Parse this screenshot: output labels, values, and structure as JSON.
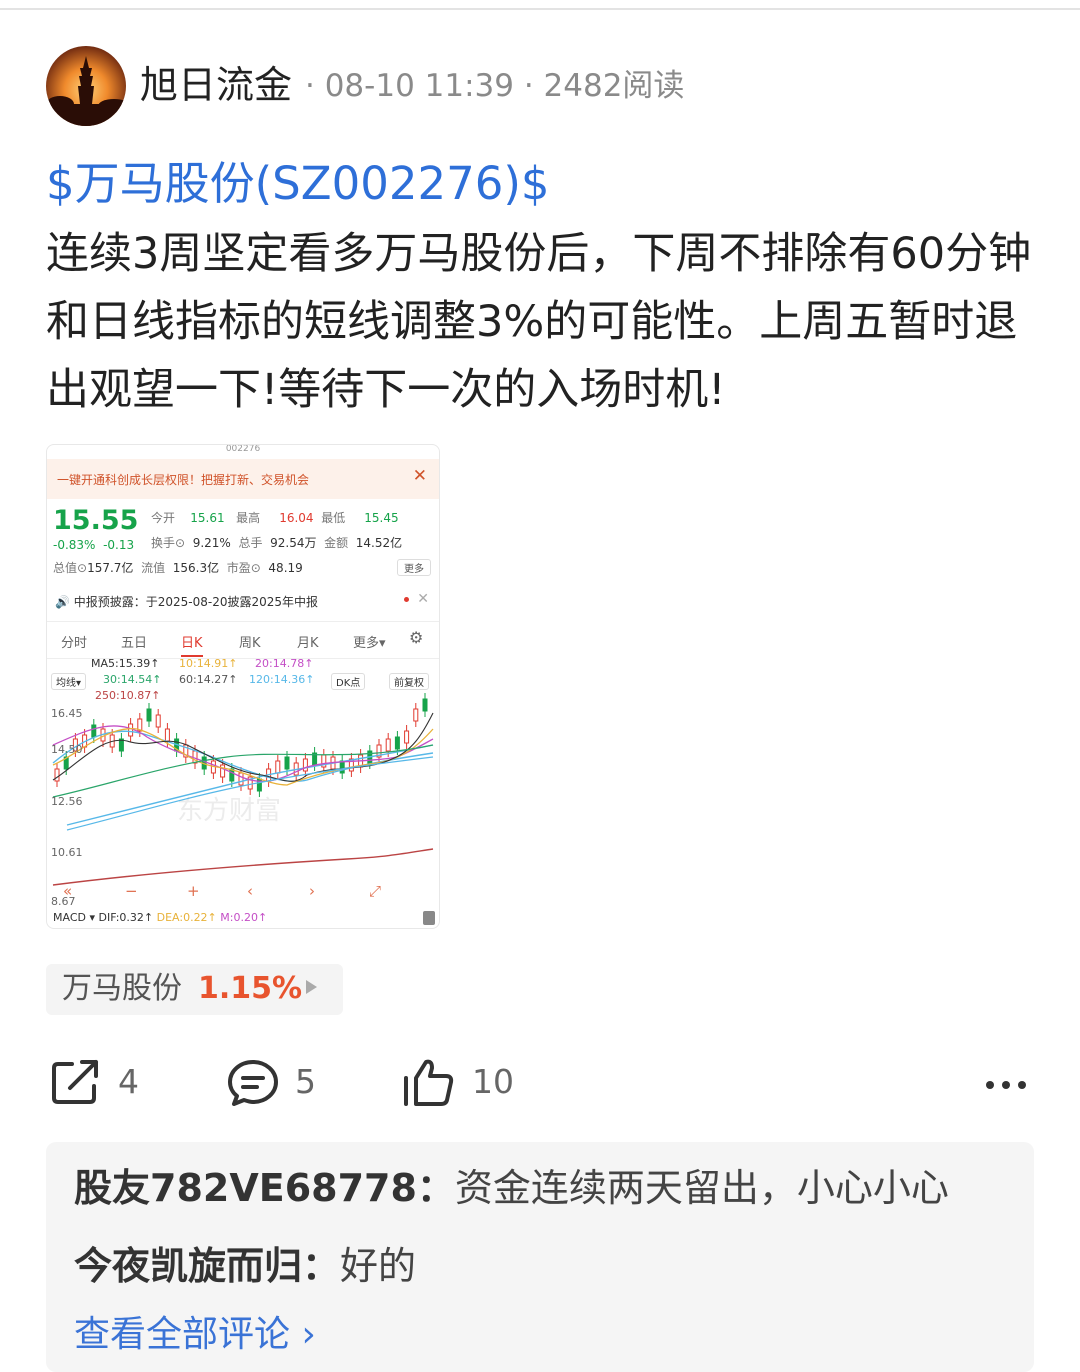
{
  "post": {
    "author": "旭日流金",
    "meta": "· 08-10 11:39 · 2482阅读",
    "ticker": "$万马股份(SZ002276)$",
    "body": "连续3周坚定看多万马股份后，下周不排除有60分钟和日线指标的短线调整3%的可能性。上周五暂时退出观望一下!等待下一次的入场时机!"
  },
  "screenshot": {
    "header_code": "002276",
    "banner": "一键开通科创成长层权限！把握打新、交易机会",
    "price": "15.55",
    "change_pct": "-0.83%",
    "change_abs": "-0.13",
    "quote": {
      "open_label": "今开",
      "open": "15.61",
      "high_label": "最高",
      "high": "16.04",
      "low_label": "最低",
      "low": "15.45",
      "turnover_label": "换手⊙",
      "turnover": "9.21%",
      "vol_label": "总手",
      "vol": "92.54万",
      "amount_label": "金额",
      "amount": "14.52亿",
      "mcap_label": "总值⊙",
      "mcap": "157.7亿",
      "float_label": "流值",
      "float": "156.3亿",
      "pe_label": "市盈⊙",
      "pe": "48.19",
      "more": "更多"
    },
    "notice": "中报预披露：于2025-08-20披露2025年中报",
    "tabs": [
      "分时",
      "五日",
      "日K",
      "周K",
      "月K",
      "更多▾"
    ],
    "active_tab": "日K",
    "ma": {
      "ma_switch": "均线▾",
      "ma5": "MA5:15.39↑",
      "ma10": "10:14.91↑",
      "ma20": "20:14.78↑",
      "ma30": "30:14.54↑",
      "ma60": "60:14.27↑",
      "ma120": "120:14.36↑",
      "ma250": "250:10.87↑",
      "dk": "DK点",
      "adj": "前复权"
    },
    "y_ticks": [
      "16.45",
      "14.50",
      "12.56",
      "10.61",
      "8.67"
    ],
    "watermark": "东方财富",
    "macd": {
      "label": "MACD ▾",
      "dif": "DIF:0.32↑",
      "dea": "DEA:0.22↑",
      "m": "M:0.20↑"
    },
    "colors": {
      "up": "#e03a2f",
      "down": "#16a34a",
      "ma5": "#333333",
      "ma10": "#e8b23a",
      "ma20": "#c44fc6",
      "ma30": "#2aa56a",
      "ma60": "#7a7a7a",
      "ma120": "#57b8e8",
      "ma250": "#b44"
    }
  },
  "stock_chip": {
    "name": "万马股份",
    "pct": "1.15%"
  },
  "actions": {
    "share_count": "4",
    "comment_count": "5",
    "like_count": "10"
  },
  "comments": [
    {
      "user": "股友782VE68778：",
      "text": "资金连续两天留出，小心小心"
    },
    {
      "user": "今夜凯旋而归：",
      "text": "好的"
    }
  ],
  "view_all": "查看全部评论 ›"
}
